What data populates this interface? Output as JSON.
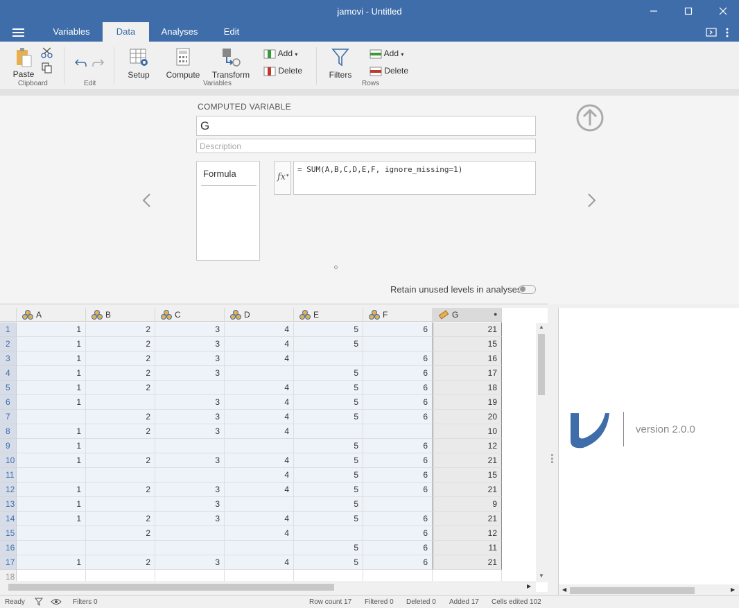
{
  "window": {
    "title": "jamovi - Untitled"
  },
  "tabs": [
    {
      "label": "Variables"
    },
    {
      "label": "Data"
    },
    {
      "label": "Analyses"
    },
    {
      "label": "Edit"
    }
  ],
  "ribbon": {
    "paste": "Paste",
    "clipboard_group": "Clipboard",
    "edit_group": "Edit",
    "setup": "Setup",
    "compute": "Compute",
    "transform": "Transform",
    "var_add": "Add",
    "var_delete": "Delete",
    "variables_group": "Variables",
    "filters": "Filters",
    "row_add": "Add",
    "row_delete": "Delete",
    "rows_group": "Rows"
  },
  "setup": {
    "heading": "COMPUTED VARIABLE",
    "name": "G",
    "description_placeholder": "Description",
    "formula_tab": "Formula",
    "fx": "fx",
    "formula": "= SUM(A,B,C,D,E,F, ignore_missing=1)",
    "retain_label": "Retain unused levels in analyses"
  },
  "sheet": {
    "columns": [
      "A",
      "B",
      "C",
      "D",
      "E",
      "F",
      "G"
    ],
    "rows": [
      [
        "1",
        "2",
        "3",
        "4",
        "5",
        "6",
        "21"
      ],
      [
        "1",
        "2",
        "3",
        "4",
        "5",
        "",
        "15"
      ],
      [
        "1",
        "2",
        "3",
        "4",
        "",
        "6",
        "16"
      ],
      [
        "1",
        "2",
        "3",
        "",
        "5",
        "6",
        "17"
      ],
      [
        "1",
        "2",
        "",
        "4",
        "5",
        "6",
        "18"
      ],
      [
        "1",
        "",
        "3",
        "4",
        "5",
        "6",
        "19"
      ],
      [
        "",
        "2",
        "3",
        "4",
        "5",
        "6",
        "20"
      ],
      [
        "1",
        "2",
        "3",
        "4",
        "",
        "",
        "10"
      ],
      [
        "1",
        "",
        "",
        "",
        "5",
        "6",
        "12"
      ],
      [
        "1",
        "2",
        "3",
        "4",
        "5",
        "6",
        "21"
      ],
      [
        "",
        "",
        "",
        "4",
        "5",
        "6",
        "15"
      ],
      [
        "1",
        "2",
        "3",
        "4",
        "5",
        "6",
        "21"
      ],
      [
        "1",
        "",
        "3",
        "",
        "5",
        "",
        "9"
      ],
      [
        "1",
        "2",
        "3",
        "4",
        "5",
        "6",
        "21"
      ],
      [
        "",
        "2",
        "",
        "4",
        "",
        "6",
        "12"
      ],
      [
        "",
        "",
        "",
        "",
        "5",
        "6",
        "11"
      ],
      [
        "1",
        "2",
        "3",
        "4",
        "5",
        "6",
        "21"
      ]
    ],
    "row_numbers": [
      "1",
      "2",
      "3",
      "4",
      "5",
      "6",
      "7",
      "8",
      "9",
      "10",
      "11",
      "12",
      "13",
      "14",
      "15",
      "16",
      "17",
      "18"
    ]
  },
  "results": {
    "version": "version 2.0.0"
  },
  "status": {
    "ready": "Ready",
    "filters": "Filters 0",
    "row_count": "Row count 17",
    "filtered": "Filtered 0",
    "deleted": "Deleted 0",
    "added": "Added 17",
    "cells_edited": "Cells edited 102"
  },
  "colors": {
    "brand": "#3e6da9",
    "cell_bg": "#eef3f9"
  }
}
